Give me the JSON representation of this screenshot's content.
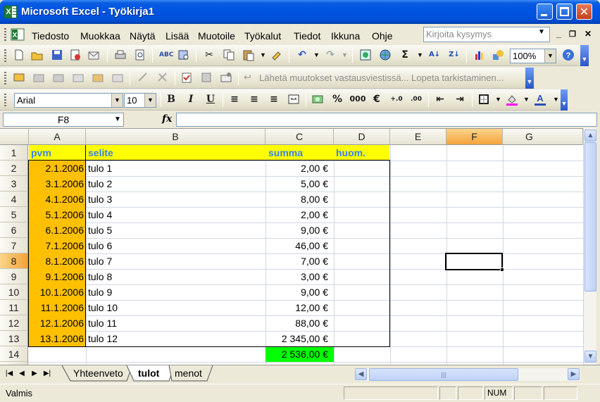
{
  "window": {
    "title": "Microsoft Excel - Työkirja1"
  },
  "menu": {
    "items": [
      "Tiedosto",
      "Muokkaa",
      "Näytä",
      "Lisää",
      "Muotoile",
      "Työkalut",
      "Tiedot",
      "Ikkuna",
      "Ohje"
    ],
    "ask_placeholder": "Kirjoita kysymys"
  },
  "standard_toolbar": {
    "zoom": "100%"
  },
  "reviewing_toolbar": {
    "text": "Lähetä muutokset vastausviestissä... Lopeta tarkistaminen..."
  },
  "formatting_toolbar": {
    "font": "Arial",
    "size": "10",
    "bold": "B",
    "italic": "I",
    "underline": "U",
    "percent": "%",
    "thousands": "000",
    "euro": "€"
  },
  "formula_bar": {
    "name_box": "F8",
    "fx": "fx",
    "value": ""
  },
  "grid": {
    "columns": [
      "A",
      "B",
      "C",
      "D",
      "E",
      "F",
      "G"
    ],
    "rows": [
      "1",
      "2",
      "3",
      "4",
      "5",
      "6",
      "7",
      "8",
      "9",
      "10",
      "11",
      "12",
      "13",
      "14",
      "15"
    ],
    "header": {
      "a": "pvm",
      "b": "selite",
      "c": "summa",
      "d": "huom."
    },
    "data": [
      [
        "2.1.2006",
        "tulo 1",
        "2,00 €"
      ],
      [
        "3.1.2006",
        "tulo 2",
        "5,00 €"
      ],
      [
        "4.1.2006",
        "tulo 3",
        "8,00 €"
      ],
      [
        "5.1.2006",
        "tulo 4",
        "2,00 €"
      ],
      [
        "6.1.2006",
        "tulo 5",
        "9,00 €"
      ],
      [
        "7.1.2006",
        "tulo 6",
        "46,00 €"
      ],
      [
        "8.1.2006",
        "tulo 7",
        "7,00 €"
      ],
      [
        "9.1.2006",
        "tulo 8",
        "3,00 €"
      ],
      [
        "10.1.2006",
        "tulo 9",
        "9,00 €"
      ],
      [
        "11.1.2006",
        "tulo 10",
        "12,00 €"
      ],
      [
        "12.1.2006",
        "tulo 11",
        "88,00 €"
      ],
      [
        "13.1.2006",
        "tulo 12",
        "2 345,00 €"
      ]
    ],
    "total": "2 536,00 €",
    "active_cell": "F8"
  },
  "sheets": [
    "Yhteenveto",
    "tulot",
    "menot"
  ],
  "active_sheet": "tulot",
  "status": {
    "text": "Valmis",
    "num": "NUM"
  },
  "colors": {
    "date_fill": "#ffc000",
    "header_fill": "#ffff00",
    "total_fill": "#00ff00",
    "header_text": "#3a82e8",
    "selected_header": "#f4a23a"
  },
  "icons": [
    "excel-app-icon",
    "workbook-icon",
    "new-icon",
    "open-icon",
    "save-icon",
    "permission-icon",
    "email-icon",
    "print-icon",
    "print-preview-icon",
    "spelling-icon",
    "research-icon",
    "cut-icon",
    "copy-icon",
    "paste-icon",
    "format-painter-icon",
    "undo-icon",
    "redo-icon",
    "hyperlink-icon",
    "autosum-icon",
    "sort-asc-icon",
    "sort-desc-icon",
    "chart-wizard-icon",
    "drawing-icon",
    "help-icon",
    "fx-icon",
    "borders-icon",
    "fill-color-icon",
    "font-color-icon"
  ]
}
